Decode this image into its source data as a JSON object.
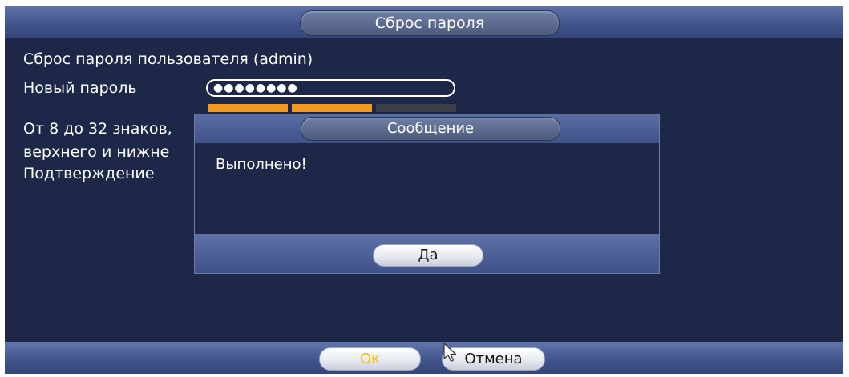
{
  "window": {
    "title": "Сброс пароля"
  },
  "form": {
    "reset_label": "Сброс пароля пользователя (admin)",
    "new_password_label": "Новый пароль",
    "new_password_value": "●●●●●●●●",
    "hint_line1": "От 8 до 32 знаков,",
    "hint_line2": "верхнего и нижне",
    "confirm_label": "Подтверждение",
    "strength": {
      "level": 2,
      "max": 3,
      "colors": {
        "active": "#f39a1f",
        "inactive": "#3b3f47"
      }
    }
  },
  "dialog": {
    "title": "Сообщение",
    "message": "Выполнено!",
    "ok_label": "Да"
  },
  "footer": {
    "ok_label": "Ок",
    "cancel_label": "Отмена",
    "ok_color": "#f2c200"
  },
  "colors": {
    "background": "#1d2848",
    "accent": "#4a5d96",
    "text": "#ffffff"
  },
  "icons": {
    "cursor": "mouse-pointer-icon"
  }
}
